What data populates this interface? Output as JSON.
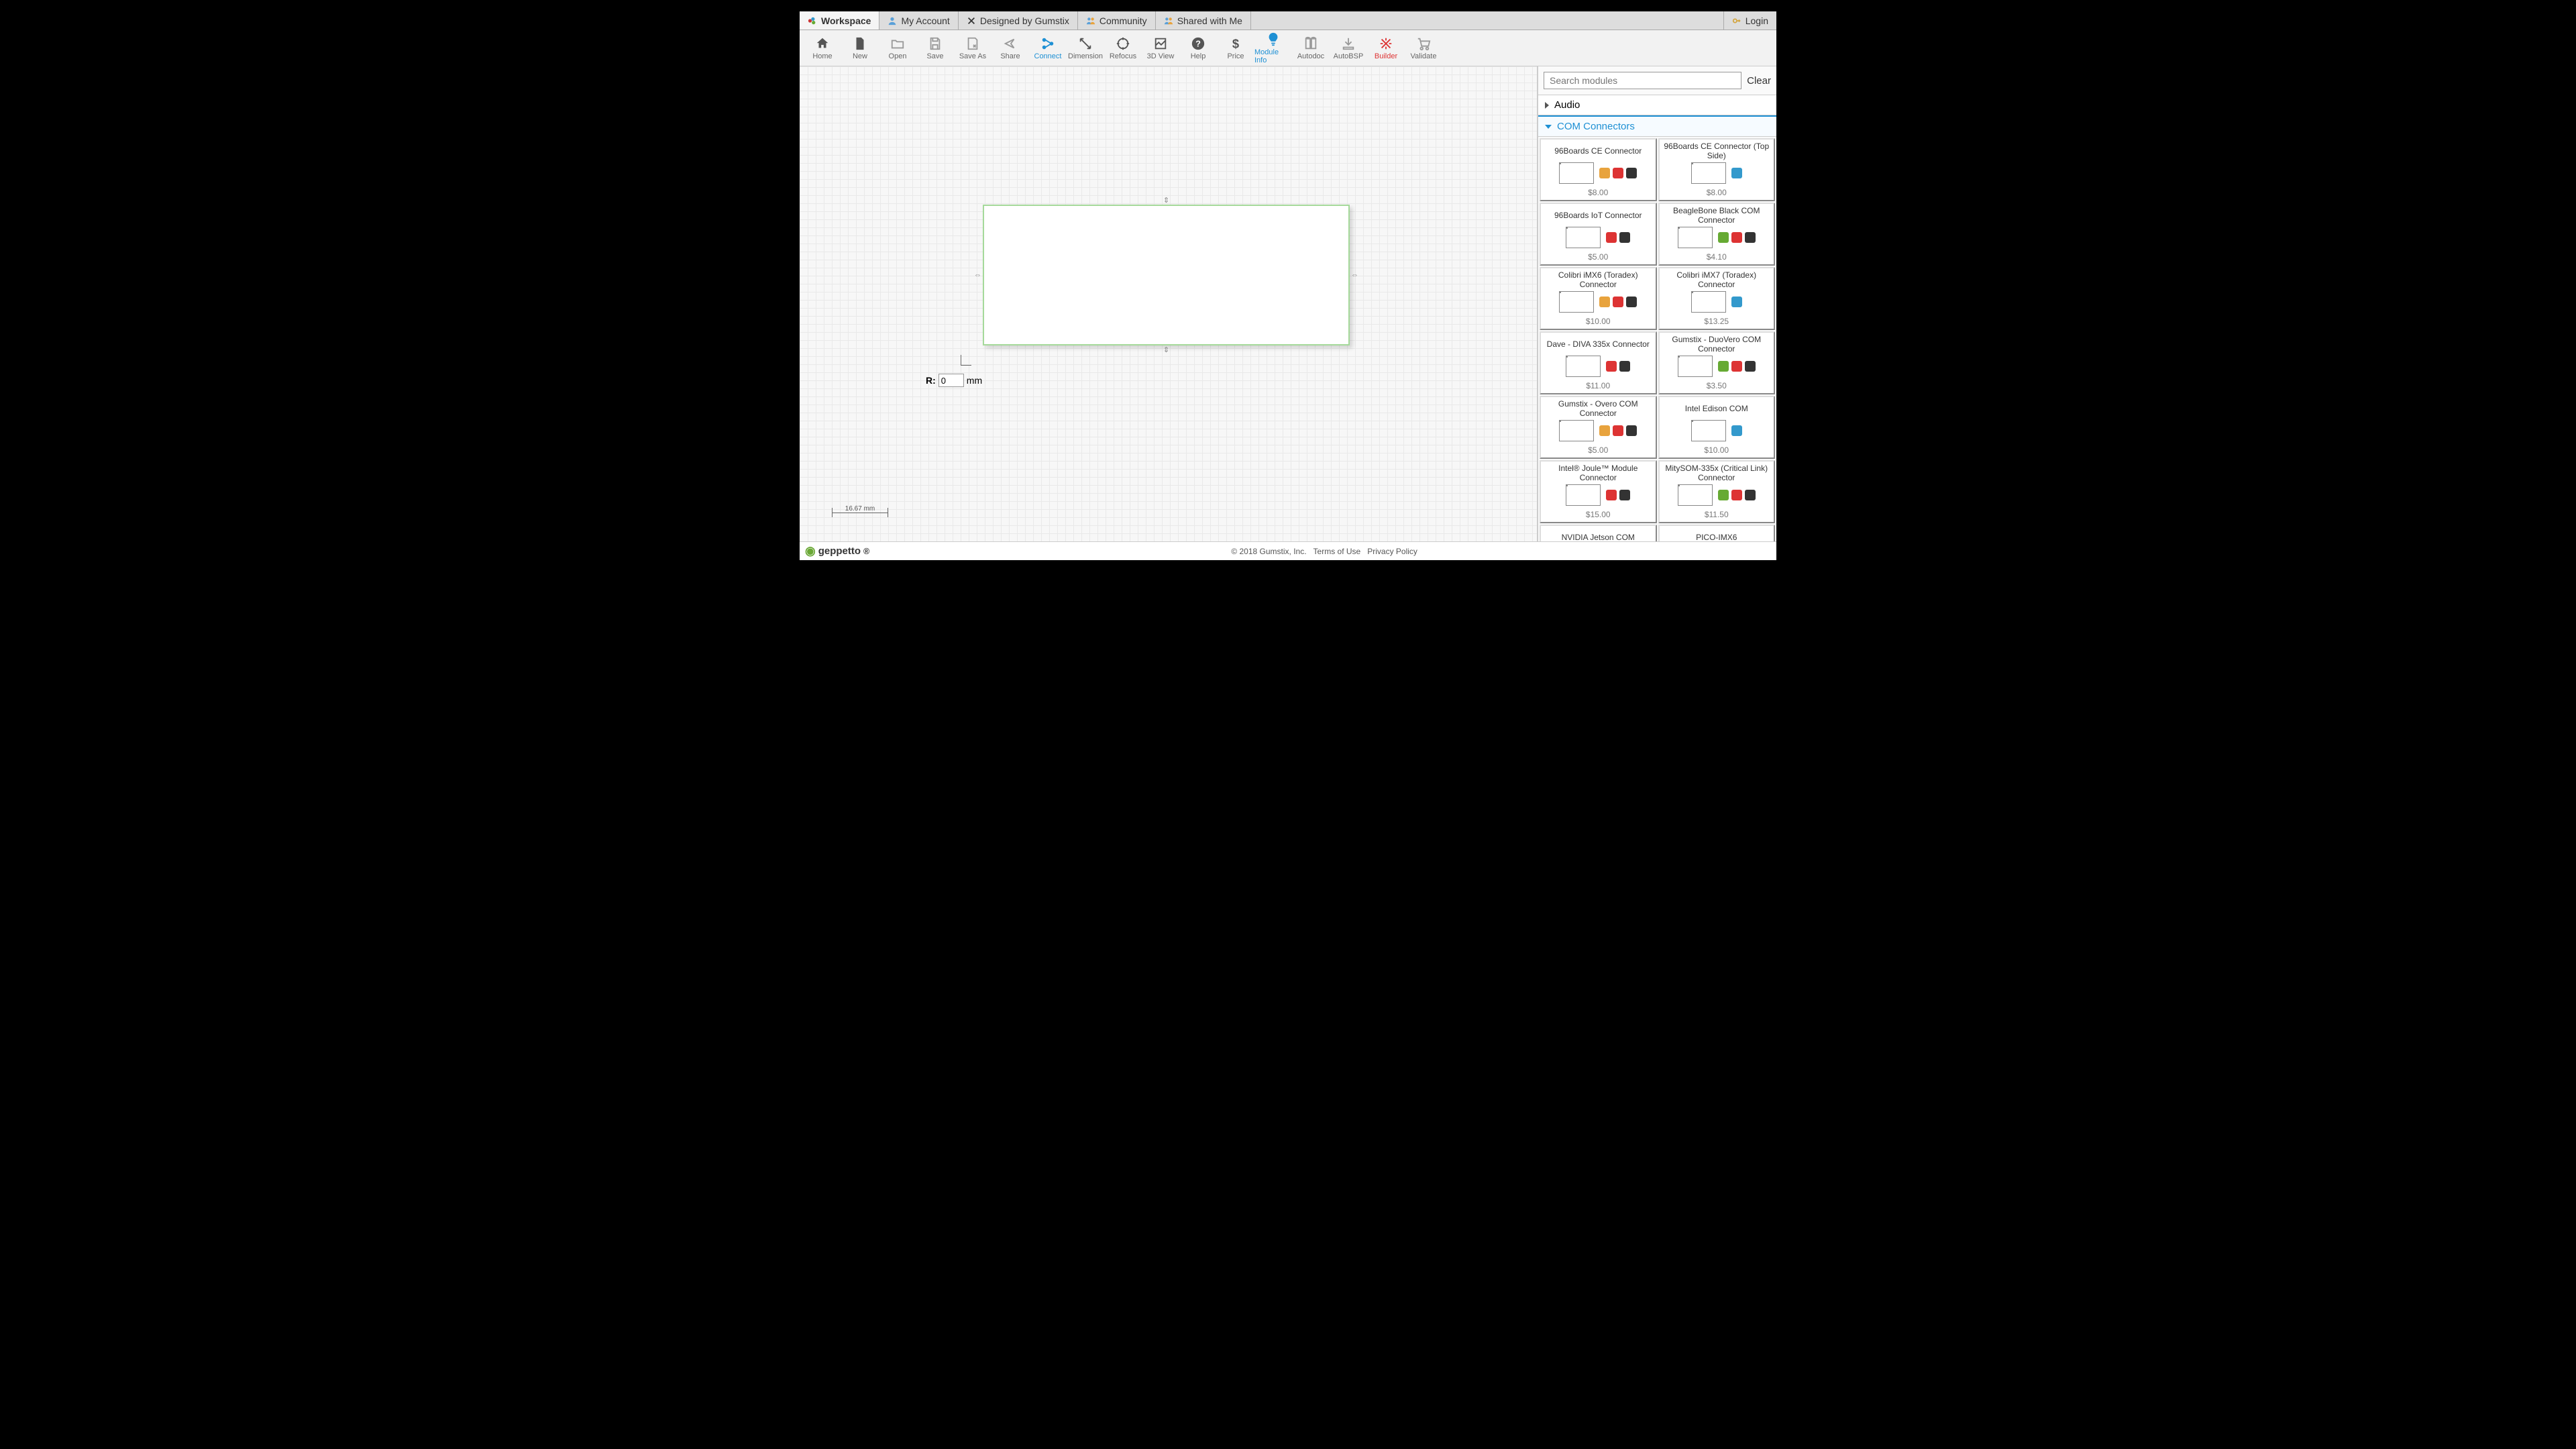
{
  "tabs": {
    "workspace": "Workspace",
    "account": "My Account",
    "designed": "Designed by Gumstix",
    "community": "Community",
    "shared": "Shared with Me",
    "login": "Login"
  },
  "toolbar": {
    "home": "Home",
    "new": "New",
    "open": "Open",
    "save": "Save",
    "saveas": "Save As",
    "share": "Share",
    "connect": "Connect",
    "dimension": "Dimension",
    "refocus": "Refocus",
    "view3d": "3D View",
    "help": "Help",
    "price": "Price",
    "moduleinfo": "Module Info",
    "autodoc": "Autodoc",
    "autobsp": "AutoBSP",
    "builder": "Builder",
    "validate": "Validate"
  },
  "search": {
    "placeholder": "Search modules",
    "clear": "Clear"
  },
  "categories": {
    "audio": "Audio",
    "com": "COM Connectors"
  },
  "modules": [
    {
      "name": "96Boards CE Connector",
      "price": "$8.00"
    },
    {
      "name": "96Boards CE Connector (Top Side)",
      "price": "$8.00"
    },
    {
      "name": "96Boards IoT Connector",
      "price": "$5.00"
    },
    {
      "name": "BeagleBone Black COM Connector",
      "price": "$4.10"
    },
    {
      "name": "Colibri iMX6 (Toradex) Connector",
      "price": "$10.00"
    },
    {
      "name": "Colibri iMX7 (Toradex) Connector",
      "price": "$13.25"
    },
    {
      "name": "Dave - DIVA 335x Connector",
      "price": "$11.00"
    },
    {
      "name": "Gumstix - DuoVero COM Connector",
      "price": "$3.50"
    },
    {
      "name": "Gumstix - Overo COM Connector",
      "price": "$5.00"
    },
    {
      "name": "Intel Edison COM",
      "price": "$10.00"
    },
    {
      "name": "Intel® Joule™ Module Connector",
      "price": "$15.00"
    },
    {
      "name": "MitySOM-335x (Critical Link) Connector",
      "price": "$11.50"
    },
    {
      "name": "NVIDIA Jetson COM",
      "price": ""
    },
    {
      "name": "PICO-IMX6",
      "price": ""
    }
  ],
  "canvas": {
    "r_label": "R:",
    "r_value": "0",
    "r_unit": "mm",
    "scale": "16.67 mm"
  },
  "footer": {
    "brand": "geppetto",
    "copyright": "© 2018 Gumstix, Inc.",
    "terms": "Terms of Use",
    "privacy": "Privacy Policy"
  }
}
